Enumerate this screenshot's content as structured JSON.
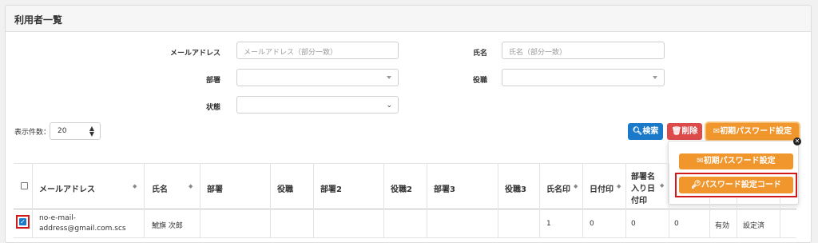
{
  "panel": {
    "title": "利用者一覧"
  },
  "filters": {
    "email_label": "メールアドレス",
    "email_placeholder": "メールアドレス（部分一致）",
    "name_label": "氏名",
    "name_placeholder": "氏名（部分一致）",
    "dept_label": "部署",
    "role_label": "役職",
    "status_label": "状態"
  },
  "per_page": {
    "label": "表示件数：",
    "value": "20"
  },
  "toolbar": {
    "search_label": "検索",
    "delete_label": "削除",
    "init_password_label": "初期パスワード設定"
  },
  "dropdown": {
    "item_init_password": "初期パスワード設定",
    "item_password_code": "パスワード設定コード"
  },
  "table": {
    "headers": {
      "email": "メールアドレス",
      "name": "氏名",
      "dept": "部署",
      "role": "役職",
      "dept2": "部署2",
      "role2": "役職2",
      "dept3": "部署3",
      "role3": "役職3",
      "name_seal": "氏名印",
      "date_seal": "日付印",
      "dept_date_seal_1": "部署名",
      "dept_date_seal_2": "入り日",
      "dept_date_seal_3": "付印"
    },
    "row": {
      "email_1": "no-e-mail-",
      "email_2": "address@gmail.com.scs",
      "name": "鯱旗 次郎",
      "name_seal": "1",
      "date_seal": "0",
      "dept_date_seal": "0",
      "extra": "0",
      "status": "有効",
      "password": "設定済"
    }
  },
  "colors": {
    "primary": "#1a7ac9",
    "danger": "#dc4a4a",
    "warning": "#f0962d",
    "highlight": "#d11a1a"
  }
}
